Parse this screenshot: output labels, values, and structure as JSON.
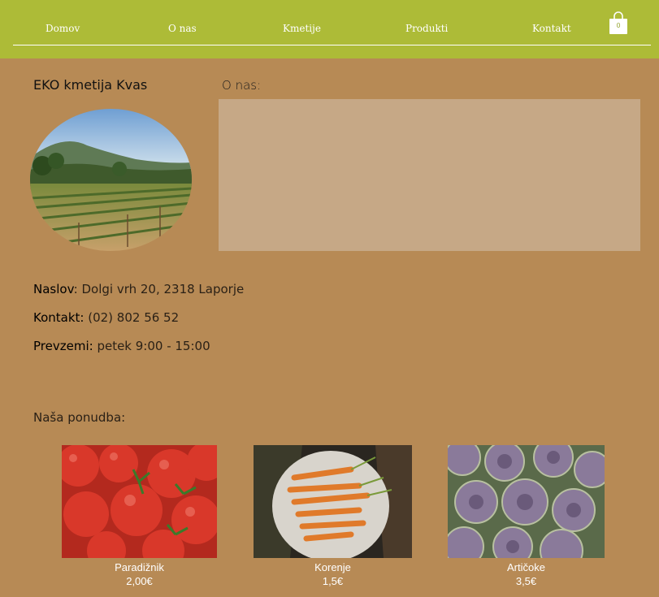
{
  "nav": {
    "items": [
      {
        "label": "Domov"
      },
      {
        "label": "O nas"
      },
      {
        "label": "Kmetije"
      },
      {
        "label": "Produkti"
      },
      {
        "label": "Kontakt"
      }
    ],
    "cart_count": "0",
    "cart_icon": "shopping-bag-icon"
  },
  "farm": {
    "title": "EKO kmetija Kvas",
    "photo": "vineyard-photo"
  },
  "about": {
    "label": "O nas:"
  },
  "info": {
    "address_label": "Naslov",
    "address_value": ": Dolgi vrh 20, 2318 Laporje",
    "contact_label": "Kontakt:",
    "contact_value": " (02) 802 56 52",
    "pickup_label": "Prevzemi:",
    "pickup_value": " petek 9:00 - 15:00"
  },
  "offer": {
    "title": "Naša ponudba:",
    "products": [
      {
        "name": "Paradižnik",
        "price": "2,00€",
        "image": "tomatoes-photo"
      },
      {
        "name": "Korenje",
        "price": "1,5€",
        "image": "carrots-photo"
      },
      {
        "name": "Artičoke",
        "price": "3,5€",
        "image": "artichokes-photo"
      }
    ]
  },
  "colors": {
    "header": "#adbb37",
    "background": "#b78a55",
    "about_box": "#c6a886"
  }
}
